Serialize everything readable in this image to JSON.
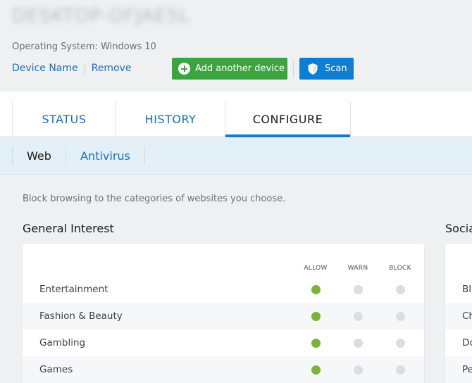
{
  "device": {
    "name": "DESKTOP-OFJAE5L",
    "os_line": "Operating System: Windows 10",
    "links": {
      "device_name": "Device Name",
      "remove": "Remove"
    }
  },
  "actions": {
    "add_device": "Add another device",
    "scan": "Scan"
  },
  "tabs": [
    {
      "label": "STATUS",
      "active": false
    },
    {
      "label": "HISTORY",
      "active": false
    },
    {
      "label": "CONFIGURE",
      "active": true
    }
  ],
  "subtabs": [
    {
      "label": "Web",
      "active": true
    },
    {
      "label": "Antivirus",
      "active": false
    }
  ],
  "description": "Block browsing to the categories of websites you choose.",
  "general": {
    "title": "General Interest",
    "columns": [
      "ALLOW",
      "WARN",
      "BLOCK"
    ],
    "rows": [
      {
        "label": "Entertainment",
        "selected": "ALLOW"
      },
      {
        "label": "Fashion & Beauty",
        "selected": "ALLOW"
      },
      {
        "label": "Gambling",
        "selected": "ALLOW"
      },
      {
        "label": "Games",
        "selected": "ALLOW"
      }
    ]
  },
  "social": {
    "title": "Social",
    "rows": [
      "Bl",
      "Ch",
      "Do",
      "Pe"
    ]
  },
  "colors": {
    "accent": "#0f7dd1",
    "add_button": "#3aa53f",
    "allow_dot": "#7bb23a",
    "off_dot": "#dcdde0"
  }
}
